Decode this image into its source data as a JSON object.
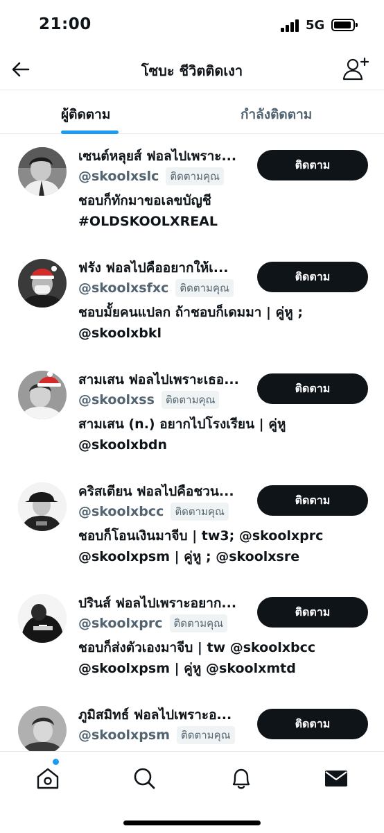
{
  "status_bar": {
    "time": "21:00",
    "network": "5G"
  },
  "header": {
    "title": "โซบะ ชีวิตติดเงา",
    "back_icon": "arrow-left-icon",
    "add_user_icon": "add-user-icon"
  },
  "tabs": [
    {
      "label": "ผู้ติดตาม",
      "active": true
    },
    {
      "label": "กำลังติดตาม",
      "active": false
    }
  ],
  "colors": {
    "accent": "#1d9bf0",
    "button_bg": "#0f1419",
    "secondary_text": "#536471",
    "badge_bg": "#eff3f4"
  },
  "followers": [
    {
      "name": "เซนต์หลุยส์ ฟอลไปเพราะ...",
      "handle": "@skoolxslc",
      "follows_you_label": "ติดตามคุณ",
      "bio_line1": "ชอบก็ทักมาขอเลขบัญชี",
      "bio_line2": "#OLDSKOOLXREAL",
      "button_label": "ติดตาม"
    },
    {
      "name": "ฟรัง ฟอลไปคืออยากให้เ...",
      "handle": "@skoolxsfxc",
      "follows_you_label": "ติดตามคุณ",
      "bio_line1": "ชอบมั้ยคนแปลก ถ้าชอบก็เดมมา | คู่หู ;",
      "bio_line2": "@skoolxbkl",
      "button_label": "ติดตาม"
    },
    {
      "name": "สามเสน ฟอลไปเพราะเธอ...",
      "handle": "@skoolxss",
      "follows_you_label": "ติดตามคุณ",
      "bio_line1": "สามเสน (n.) อยากไปโรงเรียน | คู่หู",
      "bio_line2": "@skoolxbdn",
      "button_label": "ติดตาม"
    },
    {
      "name": "คริสเตียน ฟอลไปคือชวน...",
      "handle": "@skoolxbcc",
      "follows_you_label": "ติดตามคุณ",
      "bio_line1": "ชอบก็โอนเงินมาจีบ | tw3; @skoolxprc",
      "bio_line2": "@skoolxpsm | คู่หู ; @skoolxsre",
      "button_label": "ติดตาม"
    },
    {
      "name": "ปรินส์ ฟอลไปเพราะอยาก...",
      "handle": "@skoolxprc",
      "follows_you_label": "ติดตามคุณ",
      "bio_line1": "ชอบก็ส่งตัวเองมาจีบ | tw @skoolxbcc",
      "bio_line2": "@skoolxpsm | คู่หู @skoolxmtd",
      "button_label": "ติดตาม"
    },
    {
      "name": "ภูมิสมิทธ์ ฟอลไปเพราะอ...",
      "handle": "@skoolxpsm",
      "follows_you_label": "ติดตามคุณ",
      "bio_line1": "",
      "bio_line2": "",
      "button_label": "ติดตาม"
    }
  ],
  "bottom_nav": [
    {
      "icon": "home-icon",
      "has_notification_dot": true
    },
    {
      "icon": "search-icon"
    },
    {
      "icon": "bell-icon"
    },
    {
      "icon": "mail-icon"
    }
  ]
}
